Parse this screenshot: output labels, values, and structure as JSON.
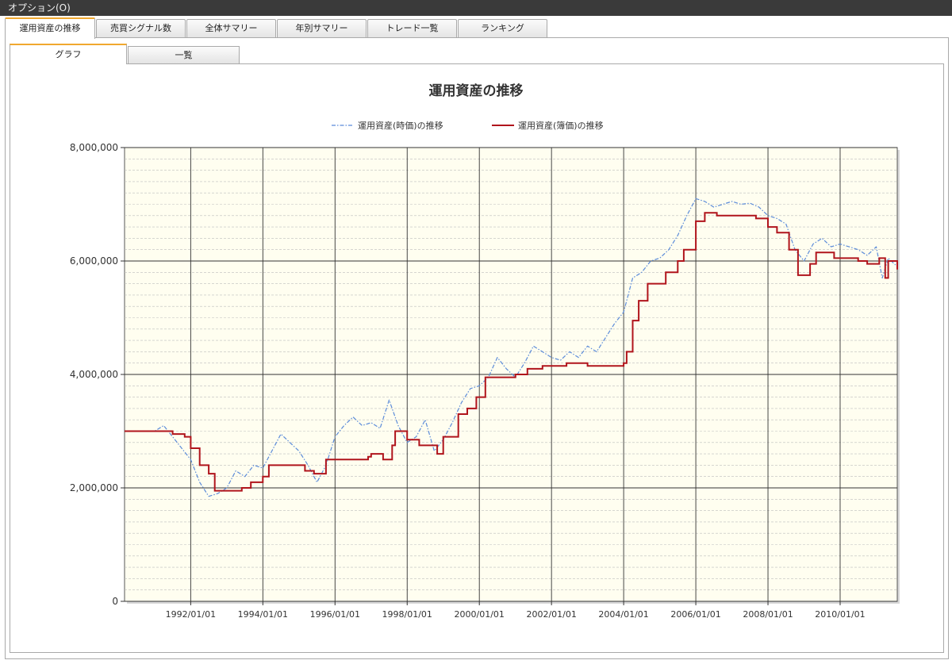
{
  "menu": {
    "options_label": "オプション(O)"
  },
  "tabs": [
    {
      "label": "運用資産の推移",
      "active": true
    },
    {
      "label": "売買シグナル数",
      "active": false
    },
    {
      "label": "全体サマリー",
      "active": false
    },
    {
      "label": "年別サマリー",
      "active": false
    },
    {
      "label": "トレード一覧",
      "active": false
    },
    {
      "label": "ランキング",
      "active": false
    }
  ],
  "subtabs": [
    {
      "label": "グラフ",
      "active": true
    },
    {
      "label": "一覧",
      "active": false
    }
  ],
  "colors": {
    "market_series": "#5b8bd9",
    "book_series": "#b0141c",
    "plot_background": "#fffef0",
    "accent_tab": "#f0a82f"
  },
  "chart_data": {
    "type": "line",
    "title": "運用資産の推移",
    "legend_position": "top",
    "grid": true,
    "x_ticks": [
      "1992/01/01",
      "1994/01/01",
      "1996/01/01",
      "1998/01/01",
      "2000/01/01",
      "2002/01/01",
      "2004/01/01",
      "2006/01/01",
      "2008/01/01",
      "2010/01/01"
    ],
    "y_ticks": [
      "0",
      "2,000,000",
      "4,000,000",
      "6,000,000",
      "8,000,000"
    ],
    "xlim": [
      "1990/03/01",
      "2011/08/01"
    ],
    "ylim": [
      0,
      8000000
    ],
    "series": [
      {
        "name": "運用資産(時価)の推移",
        "style": "dash-dot",
        "points": [
          [
            "1990/03/01",
            3000000
          ],
          [
            "1991/01/01",
            3000000
          ],
          [
            "1991/04/01",
            3100000
          ],
          [
            "1991/07/01",
            2900000
          ],
          [
            "1991/10/01",
            2700000
          ],
          [
            "1992/01/01",
            2500000
          ],
          [
            "1992/04/01",
            2100000
          ],
          [
            "1992/07/01",
            1850000
          ],
          [
            "1992/10/01",
            1900000
          ],
          [
            "1993/01/01",
            2000000
          ],
          [
            "1993/04/01",
            2300000
          ],
          [
            "1993/07/01",
            2200000
          ],
          [
            "1993/10/01",
            2400000
          ],
          [
            "1994/01/01",
            2350000
          ],
          [
            "1994/04/01",
            2650000
          ],
          [
            "1994/07/01",
            2950000
          ],
          [
            "1994/10/01",
            2800000
          ],
          [
            "1995/01/01",
            2650000
          ],
          [
            "1995/04/01",
            2400000
          ],
          [
            "1995/07/01",
            2100000
          ],
          [
            "1995/10/01",
            2400000
          ],
          [
            "1996/01/01",
            2900000
          ],
          [
            "1996/04/01",
            3100000
          ],
          [
            "1996/07/01",
            3250000
          ],
          [
            "1996/10/01",
            3100000
          ],
          [
            "1997/01/01",
            3150000
          ],
          [
            "1997/04/01",
            3050000
          ],
          [
            "1997/07/01",
            3550000
          ],
          [
            "1997/10/01",
            3100000
          ],
          [
            "1998/01/01",
            2800000
          ],
          [
            "1998/04/01",
            2900000
          ],
          [
            "1998/07/01",
            3200000
          ],
          [
            "1998/10/01",
            2650000
          ],
          [
            "1999/01/01",
            2850000
          ],
          [
            "1999/04/01",
            3150000
          ],
          [
            "1999/07/01",
            3500000
          ],
          [
            "1999/10/01",
            3750000
          ],
          [
            "2000/01/01",
            3800000
          ],
          [
            "2000/04/01",
            3950000
          ],
          [
            "2000/07/01",
            4300000
          ],
          [
            "2000/10/01",
            4100000
          ],
          [
            "2001/01/01",
            3950000
          ],
          [
            "2001/04/01",
            4200000
          ],
          [
            "2001/07/01",
            4500000
          ],
          [
            "2001/10/01",
            4400000
          ],
          [
            "2002/01/01",
            4300000
          ],
          [
            "2002/04/01",
            4250000
          ],
          [
            "2002/07/01",
            4400000
          ],
          [
            "2002/10/01",
            4300000
          ],
          [
            "2003/01/01",
            4500000
          ],
          [
            "2003/04/01",
            4400000
          ],
          [
            "2003/07/01",
            4650000
          ],
          [
            "2003/10/01",
            4900000
          ],
          [
            "2004/01/01",
            5100000
          ],
          [
            "2004/04/01",
            5700000
          ],
          [
            "2004/07/01",
            5800000
          ],
          [
            "2004/10/01",
            6000000
          ],
          [
            "2005/01/01",
            6050000
          ],
          [
            "2005/04/01",
            6200000
          ],
          [
            "2005/07/01",
            6450000
          ],
          [
            "2005/10/01",
            6800000
          ],
          [
            "2006/01/01",
            7100000
          ],
          [
            "2006/04/01",
            7050000
          ],
          [
            "2006/07/01",
            6950000
          ],
          [
            "2006/10/01",
            7000000
          ],
          [
            "2007/01/01",
            7050000
          ],
          [
            "2007/04/01",
            7000000
          ],
          [
            "2007/07/01",
            7020000
          ],
          [
            "2007/10/01",
            6950000
          ],
          [
            "2008/01/01",
            6800000
          ],
          [
            "2008/04/01",
            6750000
          ],
          [
            "2008/07/01",
            6650000
          ],
          [
            "2008/10/01",
            6200000
          ],
          [
            "2009/01/01",
            6000000
          ],
          [
            "2009/04/01",
            6300000
          ],
          [
            "2009/07/01",
            6400000
          ],
          [
            "2009/10/01",
            6250000
          ],
          [
            "2010/01/01",
            6300000
          ],
          [
            "2010/04/01",
            6250000
          ],
          [
            "2010/07/01",
            6200000
          ],
          [
            "2010/10/01",
            6100000
          ],
          [
            "2011/01/01",
            6250000
          ],
          [
            "2011/03/01",
            5700000
          ],
          [
            "2011/05/01",
            6050000
          ],
          [
            "2011/08/01",
            5900000
          ]
        ]
      },
      {
        "name": "運用資産(簿価)の推移",
        "style": "step",
        "points": [
          [
            "1990/03/01",
            3000000
          ],
          [
            "1991/07/01",
            2950000
          ],
          [
            "1991/11/01",
            2900000
          ],
          [
            "1992/01/01",
            2700000
          ],
          [
            "1992/04/01",
            2400000
          ],
          [
            "1992/07/01",
            2250000
          ],
          [
            "1992/09/01",
            1950000
          ],
          [
            "1993/06/01",
            2000000
          ],
          [
            "1993/09/01",
            2100000
          ],
          [
            "1994/01/01",
            2200000
          ],
          [
            "1994/03/01",
            2400000
          ],
          [
            "1995/03/01",
            2300000
          ],
          [
            "1995/06/01",
            2250000
          ],
          [
            "1995/10/01",
            2500000
          ],
          [
            "1996/06/01",
            2500000
          ],
          [
            "1996/12/01",
            2550000
          ],
          [
            "1997/01/01",
            2600000
          ],
          [
            "1997/05/01",
            2500000
          ],
          [
            "1997/08/01",
            2750000
          ],
          [
            "1997/09/01",
            3000000
          ],
          [
            "1998/01/01",
            2850000
          ],
          [
            "1998/05/01",
            2750000
          ],
          [
            "1998/11/01",
            2600000
          ],
          [
            "1999/01/01",
            2900000
          ],
          [
            "1999/06/01",
            3300000
          ],
          [
            "1999/09/01",
            3400000
          ],
          [
            "1999/12/01",
            3600000
          ],
          [
            "2000/03/01",
            3950000
          ],
          [
            "2001/01/01",
            4000000
          ],
          [
            "2001/05/01",
            4100000
          ],
          [
            "2001/10/01",
            4150000
          ],
          [
            "2002/03/01",
            4150000
          ],
          [
            "2002/06/01",
            4200000
          ],
          [
            "2003/01/01",
            4150000
          ],
          [
            "2003/06/01",
            4150000
          ],
          [
            "2004/01/01",
            4200000
          ],
          [
            "2004/02/01",
            4400000
          ],
          [
            "2004/04/01",
            4950000
          ],
          [
            "2004/06/01",
            5300000
          ],
          [
            "2004/09/01",
            5600000
          ],
          [
            "2005/03/01",
            5800000
          ],
          [
            "2005/07/01",
            6000000
          ],
          [
            "2005/09/01",
            6200000
          ],
          [
            "2006/01/01",
            6700000
          ],
          [
            "2006/04/01",
            6850000
          ],
          [
            "2006/08/01",
            6800000
          ],
          [
            "2007/09/01",
            6750000
          ],
          [
            "2008/01/01",
            6600000
          ],
          [
            "2008/04/01",
            6500000
          ],
          [
            "2008/08/01",
            6200000
          ],
          [
            "2008/11/01",
            5750000
          ],
          [
            "2009/03/01",
            5950000
          ],
          [
            "2009/05/01",
            6150000
          ],
          [
            "2009/11/01",
            6050000
          ],
          [
            "2010/07/01",
            6000000
          ],
          [
            "2010/10/01",
            5950000
          ],
          [
            "2011/02/01",
            6050000
          ],
          [
            "2011/04/01",
            5700000
          ],
          [
            "2011/05/01",
            6000000
          ],
          [
            "2011/08/01",
            5850000
          ]
        ]
      }
    ]
  }
}
